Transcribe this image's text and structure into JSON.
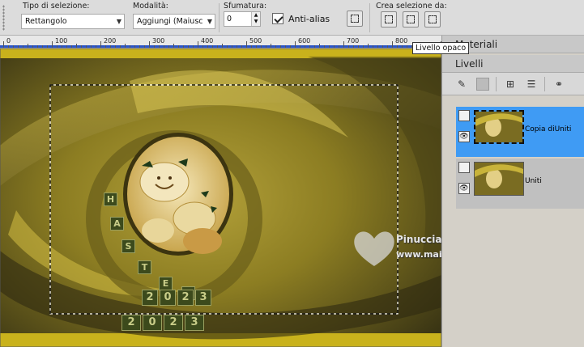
{
  "toolbar": {
    "selection_type": {
      "label": "Tipo di selezione:",
      "value": "Rettangolo"
    },
    "mode": {
      "label": "Modalità:",
      "value": "Aggiungi (Maiusc"
    },
    "feather": {
      "label": "Sfumatura:",
      "value": "0"
    },
    "antialias": {
      "label": "Anti-alias",
      "checked": true
    },
    "create_selection": {
      "label": "Crea selezione da:"
    }
  },
  "ruler": {
    "marks": [
      "0",
      "100",
      "200",
      "300",
      "400",
      "500",
      "600",
      "700",
      "800"
    ]
  },
  "tooltip": {
    "text": "Livello opaco"
  },
  "canvas": {
    "easter_letters": [
      "H",
      "A",
      "S",
      "T",
      "E",
      "R"
    ],
    "year_digits": [
      "2",
      "0",
      "2",
      "3"
    ],
    "watermark_name": "Pinuccia",
    "watermark_url": "www.maidiregrafica.eu"
  },
  "panels": {
    "materials_title": "Materiali",
    "layers_title": "Livelli",
    "layers": [
      {
        "name": "Copia diUniti",
        "selected": true
      },
      {
        "name": "Uniti",
        "selected": false
      }
    ]
  },
  "colors": {
    "accent": "#3f9bf4",
    "ruler_bar": "#2a54c8"
  }
}
